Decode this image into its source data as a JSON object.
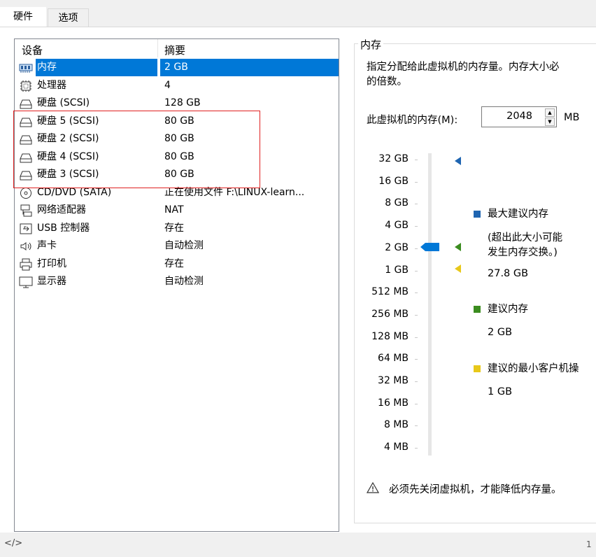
{
  "tabs": [
    {
      "label": "硬件",
      "active": true
    },
    {
      "label": "选项",
      "active": false
    }
  ],
  "device_list": {
    "headers": {
      "device": "设备",
      "summary": "摘要"
    },
    "rows": [
      {
        "icon": "memory-icon",
        "name": "内存",
        "summary": "2 GB",
        "selected": true
      },
      {
        "icon": "processor-icon",
        "name": "处理器",
        "summary": "4"
      },
      {
        "icon": "hard-disk-icon",
        "name": "硬盘 (SCSI)",
        "summary": "128 GB"
      },
      {
        "icon": "hard-disk-icon",
        "name": "硬盘 5 (SCSI)",
        "summary": "80 GB"
      },
      {
        "icon": "hard-disk-icon",
        "name": "硬盘 2 (SCSI)",
        "summary": "80 GB"
      },
      {
        "icon": "hard-disk-icon",
        "name": "硬盘 4 (SCSI)",
        "summary": "80 GB"
      },
      {
        "icon": "hard-disk-icon",
        "name": "硬盘 3 (SCSI)",
        "summary": "80 GB"
      },
      {
        "icon": "cd-dvd-icon",
        "name": "CD/DVD (SATA)",
        "summary": "正在使用文件 F:\\LINUX-learn..."
      },
      {
        "icon": "network-adapter-icon",
        "name": "网络适配器",
        "summary": "NAT"
      },
      {
        "icon": "usb-controller-icon",
        "name": "USB 控制器",
        "summary": "存在"
      },
      {
        "icon": "sound-card-icon",
        "name": "声卡",
        "summary": "自动检测"
      },
      {
        "icon": "printer-icon",
        "name": "打印机",
        "summary": "存在"
      },
      {
        "icon": "display-icon",
        "name": "显示器",
        "summary": "自动检测"
      }
    ]
  },
  "memory": {
    "group_title": "内存",
    "description": "指定分配给此虚拟机的内存量。内存大小必\n的倍数。",
    "field_label": "此虚拟机的内存(M):",
    "value": "2048",
    "unit": "MB",
    "scale_labels": [
      "32 GB",
      "16 GB",
      "8 GB",
      "4 GB",
      "2 GB",
      "1 GB",
      "512 MB",
      "256 MB",
      "128 MB",
      "64 MB",
      "32 MB",
      "16 MB",
      "8 MB",
      "4 MB"
    ],
    "current_level": "2 GB",
    "legend": {
      "max_title": "最大建议内存",
      "max_note": "(超出此大小可能\n发生内存交换。)",
      "max_value": "27.8 GB",
      "rec_title": "建议内存",
      "rec_value": "2 GB",
      "min_title": "建议的最小客户机操",
      "min_value": "1 GB"
    },
    "colors": {
      "max": "#1f65b1",
      "recommended": "#3b8c1f",
      "minimum": "#e8c81a",
      "selection": "#0078d7"
    },
    "warning": "必须先关闭虚拟机，才能降低内存量。"
  },
  "footer": {
    "code_icon": "</>",
    "page": "1"
  }
}
